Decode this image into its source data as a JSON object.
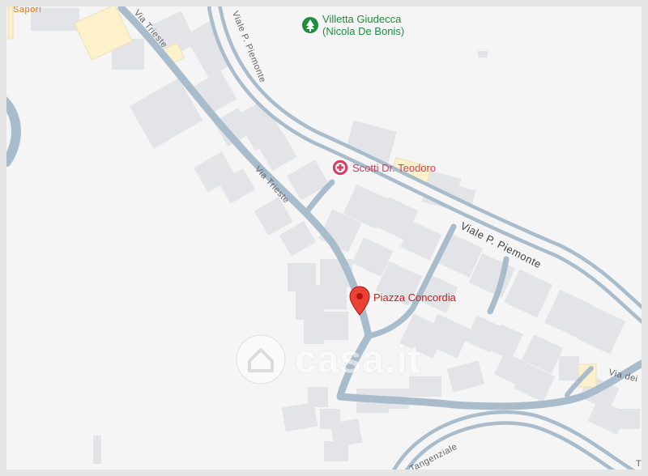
{
  "map": {
    "pois": [
      {
        "name": "Villetta Giudecca\n(Nicola De Bonis)",
        "kind": "park",
        "color": "#1e8e3e"
      },
      {
        "name": "Scotti Dr. Teodoro",
        "kind": "medical",
        "color": "#d93f62"
      },
      {
        "name": "Piazza Concordia",
        "kind": "selected-place",
        "color": "#c5221f"
      }
    ],
    "streets": {
      "via_trieste_north": "Via Trieste",
      "via_trieste_south": "Via Trieste",
      "viale_piemonte_curve": "Viale P. Piemonte",
      "viale_piemonte_main": "Viale P. Piemonte",
      "via_dei_v": "Via dei V",
      "tangenziale": "Tangenziale",
      "top_left_fragment": "Saporì",
      "right_fragment": "Tr"
    },
    "watermark": "casa.it"
  },
  "colors": {
    "background": "#f5f5f5",
    "roads": "#a9bccb",
    "buildings": "#e3e4e8",
    "highlight_buildings": "#fdf1cc"
  }
}
